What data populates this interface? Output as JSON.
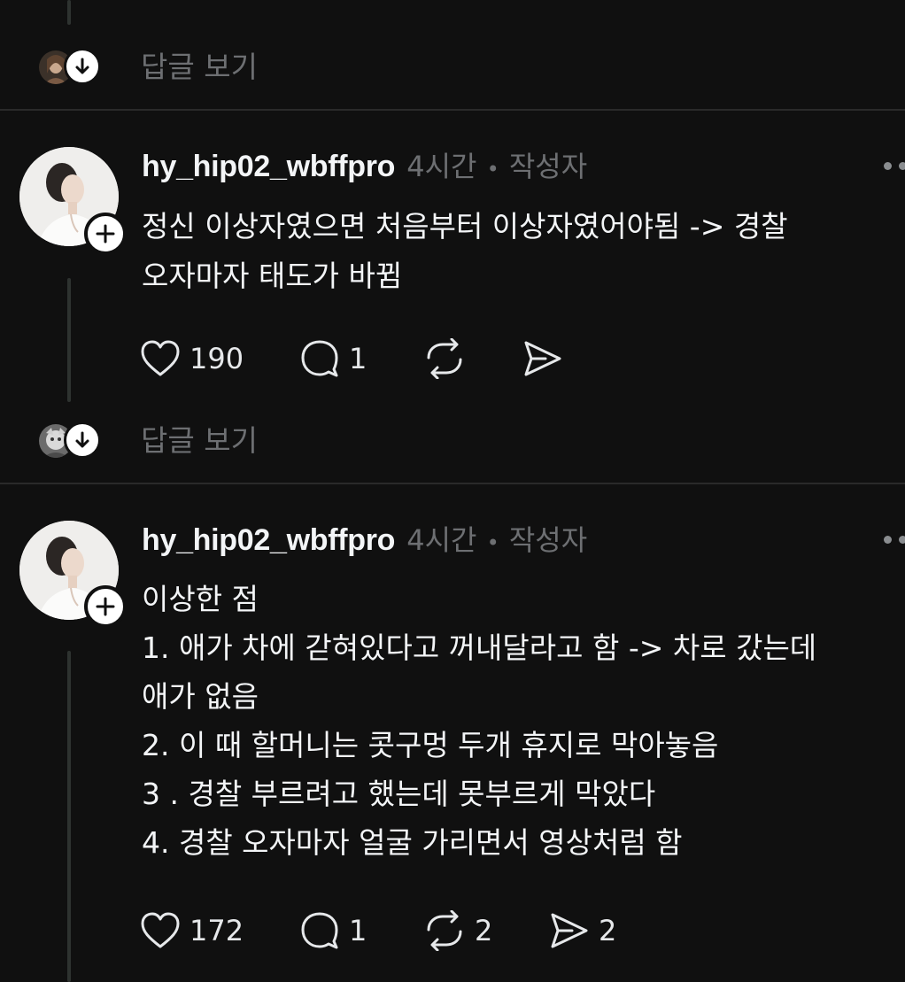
{
  "reply_label": "답글 보기",
  "colors": {
    "background": "#101010",
    "text_primary": "#f3f5f7",
    "text_secondary": "#6d6f72",
    "thread_line": "#2e3330"
  },
  "comments": [
    {
      "username": "hy_hip02_wbffpro",
      "time": "4시간",
      "separator": "•",
      "role": "작성자",
      "lines": [
        "정신 이상자였으면 처음부터 이상자였어야됨 -> 경찰",
        "오자마자 태도가 바뀜"
      ],
      "likes": "190",
      "replies": "1",
      "reposts": "",
      "shares": ""
    },
    {
      "username": "hy_hip02_wbffpro",
      "time": "4시간",
      "separator": "•",
      "role": "작성자",
      "lines": [
        "이상한 점",
        "1. 애가 차에 갇혀있다고 꺼내달라고 함 -> 차로 갔는데",
        "애가 없음",
        "2.  이 때 할머니는 콧구멍 두개 휴지로 막아놓음",
        "3 . 경찰 부르려고 했는데 못부르게 막았다",
        "4. 경찰 오자마자 얼굴 가리면서 영상처럼 함"
      ],
      "likes": "172",
      "replies": "1",
      "reposts": "2",
      "shares": "2"
    }
  ],
  "icons": {
    "like": "heart-icon",
    "reply": "comment-bubble-icon",
    "repost": "repost-icon",
    "share": "send-icon",
    "more": "more-dots-icon",
    "follow": "plus-icon",
    "expand": "arrow-down-icon"
  }
}
